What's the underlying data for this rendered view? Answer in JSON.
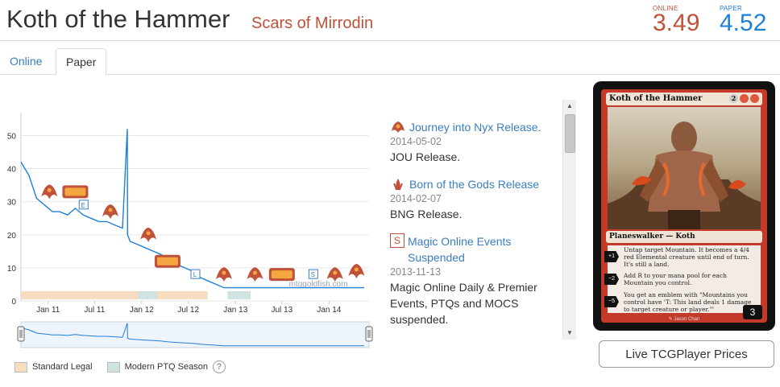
{
  "header": {
    "title": "Koth of the Hammer",
    "set": "Scars of Mirrodin",
    "online_label": "ONLINE",
    "online_price": "3.49",
    "paper_label": "PAPER",
    "paper_price": "4.52"
  },
  "tabs": [
    {
      "label": "Online",
      "active": false
    },
    {
      "label": "Paper",
      "active": true
    }
  ],
  "colors": {
    "accent_red": "#c0513a",
    "accent_blue": "#1e7fd8",
    "line": "#1e7fd8",
    "standard_legal": "#f7dcc0",
    "modern_ptq": "#cfe3e3"
  },
  "chart_data": {
    "type": "line",
    "title": "",
    "xlabel": "",
    "ylabel": "",
    "ylim": [
      0,
      55
    ],
    "yticks": [
      0,
      10,
      20,
      30,
      40,
      50
    ],
    "x_ticks": [
      "Jan 11",
      "Jul 11",
      "Jan 12",
      "Jul 12",
      "Jan 13",
      "Jul 13",
      "Jan 14"
    ],
    "x_range": [
      "2010-10",
      "2014-06"
    ],
    "series": [
      {
        "values_x": [
          "2010-10-01",
          "2010-11-01",
          "2010-12-01",
          "2011-01-01",
          "2011-02-01",
          "2011-03-01",
          "2011-04-01",
          "2011-05-01",
          "2011-06-01",
          "2011-07-01",
          "2011-08-01",
          "2011-09-01",
          "2011-10-01",
          "2011-11-01",
          "2011-11-20",
          "2011-11-21",
          "2011-12-01",
          "2012-01-01",
          "2012-02-01",
          "2012-03-01",
          "2012-04-01",
          "2012-05-01",
          "2012-06-01",
          "2012-07-01",
          "2012-08-01",
          "2012-09-01",
          "2012-10-01",
          "2012-11-01",
          "2012-12-01",
          "2013-01-01",
          "2013-03-01",
          "2013-05-01",
          "2013-07-01",
          "2013-09-01",
          "2013-11-01",
          "2014-01-01",
          "2014-03-01",
          "2014-05-01",
          "2014-06-01"
        ],
        "values_y": [
          42,
          38,
          31,
          29,
          27,
          27,
          26,
          28,
          26,
          25,
          24,
          24,
          23,
          22,
          52,
          20,
          18,
          17,
          16,
          15,
          14,
          12,
          11,
          10,
          9,
          7,
          6,
          5,
          4,
          4,
          4,
          4,
          4,
          4,
          4,
          4,
          4,
          4,
          4
        ]
      }
    ],
    "standard_legal_periods": [
      [
        "2010-10-01",
        "2012-09-28"
      ]
    ],
    "modern_ptq_periods": [
      [
        "2012-01-01",
        "2012-03-15"
      ],
      [
        "2012-12-15",
        "2013-03-15"
      ]
    ],
    "legend": [
      "Standard Legal",
      "Modern PTQ Season"
    ],
    "legend_placement": "bottom",
    "watermark": "mtggoldfish.com",
    "grid": true
  },
  "events": [
    {
      "title": "Journey into Nyx Release.",
      "date": "2014-05-02",
      "desc": "JOU Release.",
      "icon": "set-symbol-icon"
    },
    {
      "title": "Born of the Gods Release",
      "date": "2014-02-07",
      "desc": "BNG Release.",
      "icon": "set-symbol-icon"
    },
    {
      "title": "Magic Online Events Suspended",
      "date": "2013-11-13",
      "desc": "Magic Online Daily & Premier Events, PTQs and MOCS suspended.",
      "icon": "s-badge-icon",
      "icon_text": "S"
    }
  ],
  "card": {
    "name": "Koth of the Hammer",
    "mana_cost": "2RR",
    "type_line": "Planeswalker — Koth",
    "abilities": [
      {
        "cost": "+1",
        "text": "Untap target Mountain. It becomes a 4/4 red Elemental creature until end of turn. It's still a land."
      },
      {
        "cost": "−2",
        "text": "Add R to your mana pool for each Mountain you control."
      },
      {
        "cost": "−5",
        "text": "You get an emblem with \"Mountains you control have 'T: This land deals 1 damage to target creature or player.'\""
      }
    ],
    "loyalty": "3",
    "artist": "Jason Chan"
  },
  "buttons": {
    "tcg": "Live TCGPlayer Prices"
  },
  "legend": {
    "standard": "Standard Legal",
    "modern": "Modern PTQ Season",
    "help": "?"
  }
}
